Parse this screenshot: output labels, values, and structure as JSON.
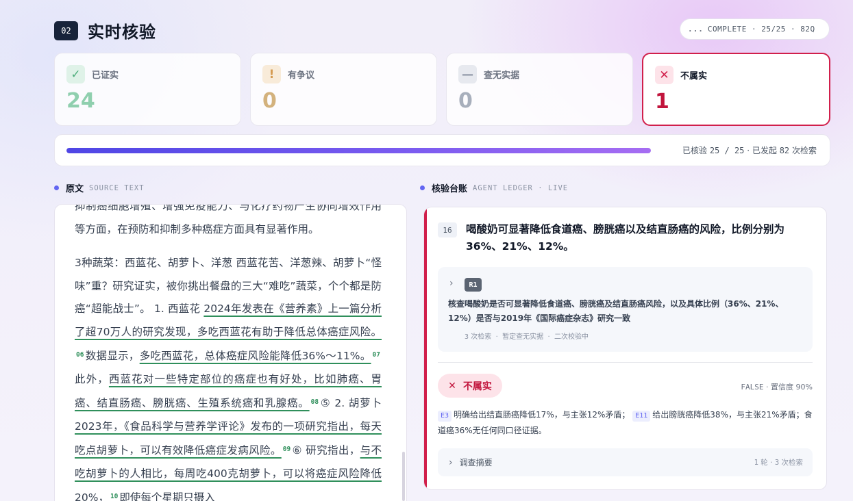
{
  "header": {
    "step": "02",
    "title": "实时核验",
    "status_dots": "...",
    "status": "COMPLETE · 25/25 · 82Q"
  },
  "stats": [
    {
      "label": "已证实",
      "value": "24",
      "icon": "check-icon",
      "color": "#4fae7d"
    },
    {
      "label": "有争议",
      "value": "0",
      "icon": "exclamation-icon",
      "color": "#d59b52"
    },
    {
      "label": "查无实据",
      "value": "0",
      "icon": "dash-icon",
      "color": "#8e96a6"
    },
    {
      "label": "不属实",
      "value": "1",
      "icon": "x-icon",
      "color": "#d11f4b"
    }
  ],
  "progress": {
    "fraction": 1.0,
    "prefix": "已核验",
    "count": "25 / 25",
    "sep": "· 已发起",
    "queries": "82",
    "suffix": "次检索"
  },
  "source": {
    "title": "原文",
    "subtitle": "SOURCE TEXT",
    "p1": "抑制癌细胞增殖、增强免疫能力、与化疗药物产生协同增效作用等方面，在预防和抑制多种癌症方面具有显著作用。",
    "p2_a": "3种蔬菜：西蓝花、胡萝卜、洋葱 西蓝花苦、洋葱辣、胡萝卜“怪味”重？研究证实，被你挑出餐盘的三大“难吃”蔬菜，个个都是防癌“超能战士”。 1. 西蓝花 ",
    "p2_h1": "2024年发表在《营养素》上一篇分析了超70万人的研究发现，多吃西蓝花有助于降低总体癌症风险。",
    "c6": "06",
    "p2_b": "数据显示，",
    "p2_h2": "多吃西蓝花，总体癌症风险能降低36%～11%。",
    "c7": "07",
    "p2_c": "此外，",
    "p2_h3": "西蓝花对一些特定部位的癌症也有好处，比如肺癌、胃癌、结直肠癌、膀胱癌、生殖系统癌和乳腺癌。",
    "c8": "08",
    "p2_d": "⑤ 2. 胡萝卜 ",
    "p2_h4": "2023年，《食品科学与营养学评论》发布的一项研究指出，每天吃点胡萝卜，可以有效降低癌症发病风险。",
    "c9": "09",
    "p2_e": "⑥ 研究指出，",
    "p2_h5": "与不吃胡萝卜的人相比，每周吃400克胡萝卜，可以将癌症风险降低20%，",
    "c10": "10",
    "p2_f": "即使每个星期只摄入"
  },
  "ledger": {
    "title": "核验台账",
    "subtitle": "AGENT LEDGER · LIVE",
    "claim_number": "16",
    "claim": "喝酸奶可显著降低食道癌、膀胱癌以及结直肠癌的风险，比例分别为36%、21%、12%。",
    "round": {
      "tag": "R1",
      "query": "核查喝酸奶是否可显著降低食道癌、膀胱癌及结直肠癌风险，以及具体比例（36%、21%、12%）是否与2019年《国际癌症杂志》研究一致",
      "meta_count": "3",
      "meta_count_label": "次检索",
      "meta_a": "暂定查无实据",
      "meta_b": "二次校验中"
    },
    "verdict": {
      "label": "不属实",
      "code": "FALSE",
      "confidence": "· 置信度 90%",
      "ev1": "E3",
      "ev1_text": "明确给出结直肠癌降低17%，与主张12%矛盾；",
      "ev2": "E11",
      "ev2_text": "给出膀胱癌降低38%，与主张21%矛盾；食道癌36%无任何同口径证据。"
    },
    "summary": {
      "label": "调查摘要",
      "rounds": "1",
      "rounds_label": "轮 ·",
      "queries": "3",
      "queries_label": "次检索"
    }
  }
}
